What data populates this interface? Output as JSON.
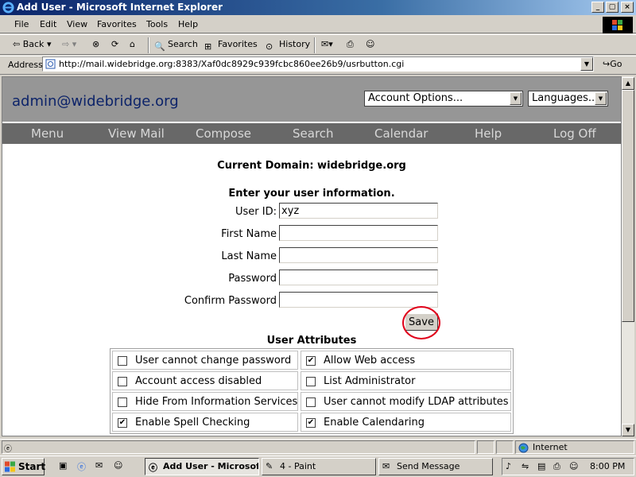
{
  "window": {
    "title": "Add User - Microsoft Internet Explorer",
    "min_glyph": "_",
    "max_glyph": "▢",
    "close_glyph": "×"
  },
  "menu": [
    "File",
    "Edit",
    "View",
    "Favorites",
    "Tools",
    "Help"
  ],
  "toolbar": {
    "back": "Back",
    "search": "Search",
    "favorites": "Favorites",
    "history": "History"
  },
  "address": {
    "label": "Address",
    "url": "http://mail.widebridge.org:8383/Xaf0dc8929c939fcbc860ee26b9/usrbutton.cgi",
    "go": "Go"
  },
  "page": {
    "brand": "admin@widebridge.org",
    "account_options": "Account Options...",
    "languages": "Languages...",
    "nav": [
      "Menu",
      "View Mail",
      "Compose",
      "Search",
      "Calendar",
      "Help",
      "Log Off"
    ],
    "current_domain": "Current Domain: widebridge.org",
    "enter_info": "Enter your user information.",
    "fields": [
      {
        "label": "User ID:",
        "value": "xyz"
      },
      {
        "label": "First Name",
        "value": ""
      },
      {
        "label": "Last Name",
        "value": ""
      },
      {
        "label": "Password",
        "value": ""
      },
      {
        "label": "Confirm Password",
        "value": ""
      }
    ],
    "save": "Save",
    "attributes_title": "User Attributes",
    "attributes": [
      {
        "label": "User cannot change password",
        "checked": false
      },
      {
        "label": "Allow Web access",
        "checked": true
      },
      {
        "label": "Account access disabled",
        "checked": false
      },
      {
        "label": "List Administrator",
        "checked": false
      },
      {
        "label": "Hide From Information Services",
        "checked": false
      },
      {
        "label": "User cannot modify LDAP attributes",
        "checked": false
      },
      {
        "label": "Enable Spell Checking",
        "checked": true
      },
      {
        "label": "Enable Calendaring",
        "checked": true
      }
    ]
  },
  "status": {
    "zone": "Internet"
  },
  "taskbar": {
    "start": "Start",
    "tasks": [
      "Add User - Microsof...",
      "4 - Paint",
      "Send Message"
    ],
    "clock": "8:00 PM"
  },
  "colors": {
    "header_bg": "#969696",
    "nav_bg": "#686868",
    "brand": "#0c2369",
    "highlight_circle": "#e0001a"
  }
}
